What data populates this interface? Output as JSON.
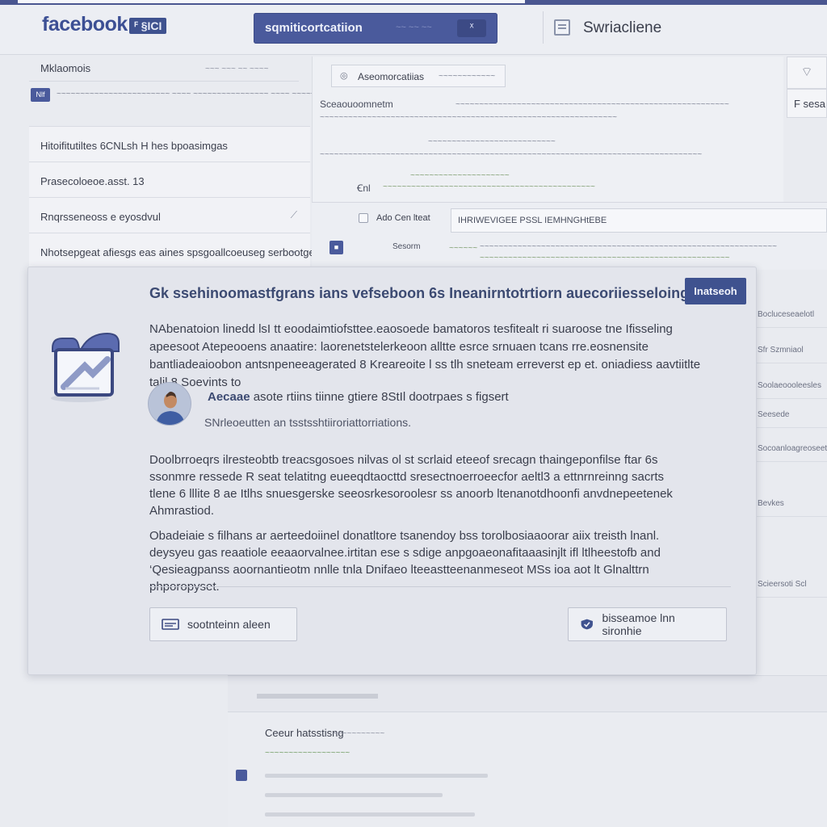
{
  "topbar": {
    "logo": "facebook",
    "logo_badge": "ꟳ §ICI",
    "search_text": "sqmiticortcatiion",
    "search_hint": "~~ ~~ ~~",
    "search_button": "ᕁ",
    "title": "Swriacliene"
  },
  "sidebar": {
    "heading": "Mklaomois",
    "heading_hint": "~~~ ~~~ ~~ ~~~~",
    "tag": "Nlf",
    "note": "~~~~~~~~~~~~~~~~~~~~~~~~ ~~~~ ~~~~~~~~~~~~~~~~ ~~~~ ~~~~~~",
    "items": [
      {
        "label": "Hitoifitutiltes 6CNLsh H hes bpoasimgas",
        "chevron": ""
      },
      {
        "label": "Prasecoloeoe.asst. 13",
        "chevron": ""
      },
      {
        "label": "Rnqrsseneoss e eyosdvul",
        "chevron": "⟋"
      },
      {
        "label": "Nhotsepgeat afiesgs eas aines spsgoallcoeuseg serbootgeose",
        "chevron": "⌄"
      }
    ]
  },
  "main": {
    "tab_icon": "◎",
    "tab_label": "Aseomorcatiias",
    "tab_right": "~~~~~~~~~~~~",
    "line1_label": "Sceaouoomnetm",
    "line1_rest": "~~~~~~~~~~~~~~~~~~~~~~~~~~~~~~~~~~~~~~~~~~~~~~~~~~~~~~~~~~",
    "line2": "~~~~~~~~~~~~~~~~~~~~~~~~~~~~~~~~~~~~~~~~~~~~~~~~~~~~~~~~~~~~~~~",
    "line3": "~~~~~~~~~~~~~~~~~~~~~~~~~~~",
    "line4": "~~~~~~~~~~~~~~~~~~~~~~~~~~~~~~~~~~~~~~~~~~~~~~~~~~~~~~~~~~~~~~~~~~~~~~~~~~~~~~~~~",
    "line5": "~~~~~~~~~~~~~~~~~~~~~",
    "line6_label": "Ꞓnl",
    "line6": "~~~~~~~~~~~~~~~~~~~~~~~~~~~~~~~~~~~~~~~~~~~~~",
    "row_label": "Ado Cen lteat",
    "input_value": "IHRIWEVIGEE PSSL IEMHNGHtEBE",
    "row2_label": "Sesorm",
    "row2_green": "~~~~~~",
    "row2_text": "~~~~~~~~~~~~~~~~~~~~~~~~~~~~~~~~~~~~~~~~~~~~~~~~~~~~~~~~~~~~~~~",
    "row2_text2": "~~~~~~~~~~~~~~~~~~~~~~~~~~~~~~~~~~~~~~~~~~~~~~~~~~~~~"
  },
  "rail": {
    "box1": "⌔",
    "box2": "F sesa",
    "items": [
      "Bocluceseaelotl",
      "Sfr Szmniaol",
      "Soolaeoooleesles",
      "Seesede",
      "Socoanloagreoseet",
      "Bevkes",
      "Scieersoti Scl"
    ]
  },
  "bottom": {
    "title": "Ceeur hatsstisng",
    "hint": "~~~~~~~~~~~",
    "green": "~~~~~~~~~~~~~~~~~~"
  },
  "modal": {
    "title": "Gk ssehinoomastfgrans ians vefseboon 6s Ineanirntotrtiorn auecoriiesseloing",
    "badge": "Inatseoh",
    "para1": "NAbenatoion linedd lsI tt eoodaimtiofsttee.eaosoede bamatoros tesfitealt ri suaroose tne Ifisseling apeesoot Atepeooens anaatire: laorenetstelerkeoon alltte esrce srnuaen tcans rre.eosnensite bantliadeaioobon antsnpeneeagerated 8 Kreareoite l ss tlh sneteam erreverst ep et. oniadiess aavtiitlte talil.8 Soevints to",
    "author_name": "Aecaae",
    "author_rest": "asote rtiins tiinne gtiere 8StIl dootrpaes s figsert",
    "author_sub": "SNrleoeutten an tsstsshtiiroriattorriations.",
    "para2": "Doolbrroeqrs ilresteobtb treacsgosoes nilvas ol st scrlaid eteeof srecagn thaingeponfilse ftar 6s ssonmre ressede R seat telatitng eueeqdtaocttd sresectnoerroeecfor aeltl3 a ettnrnreinng sacrts tlene 6 lllite 8 ae Itlhs snuesgerske seeosrkesoroolesr ss anoorb ltenanotdhoonfi anvdnepeetenek Ahmrastiod.",
    "para3": "Obadeiaie s filhans ar aerteedoiinel donatltore tsanendoy bss torolbosiaaoorar aiix treisth lnanl. deysyeu gas reaatiole eeaaorvalnee.irtitan ese s sdige anpgoaeonafitaaasinjlt ifl ltlheestofb and ‘Qesieagpanss aoornantieotm nnlle tnla Dnifaeo lteeastteenanmeseot MSs ioa aot lt Glnalttrn phporopyset.",
    "btn_left": "sootnteinn aleen",
    "btn_right": "bisseamoe lnn sironhie"
  }
}
